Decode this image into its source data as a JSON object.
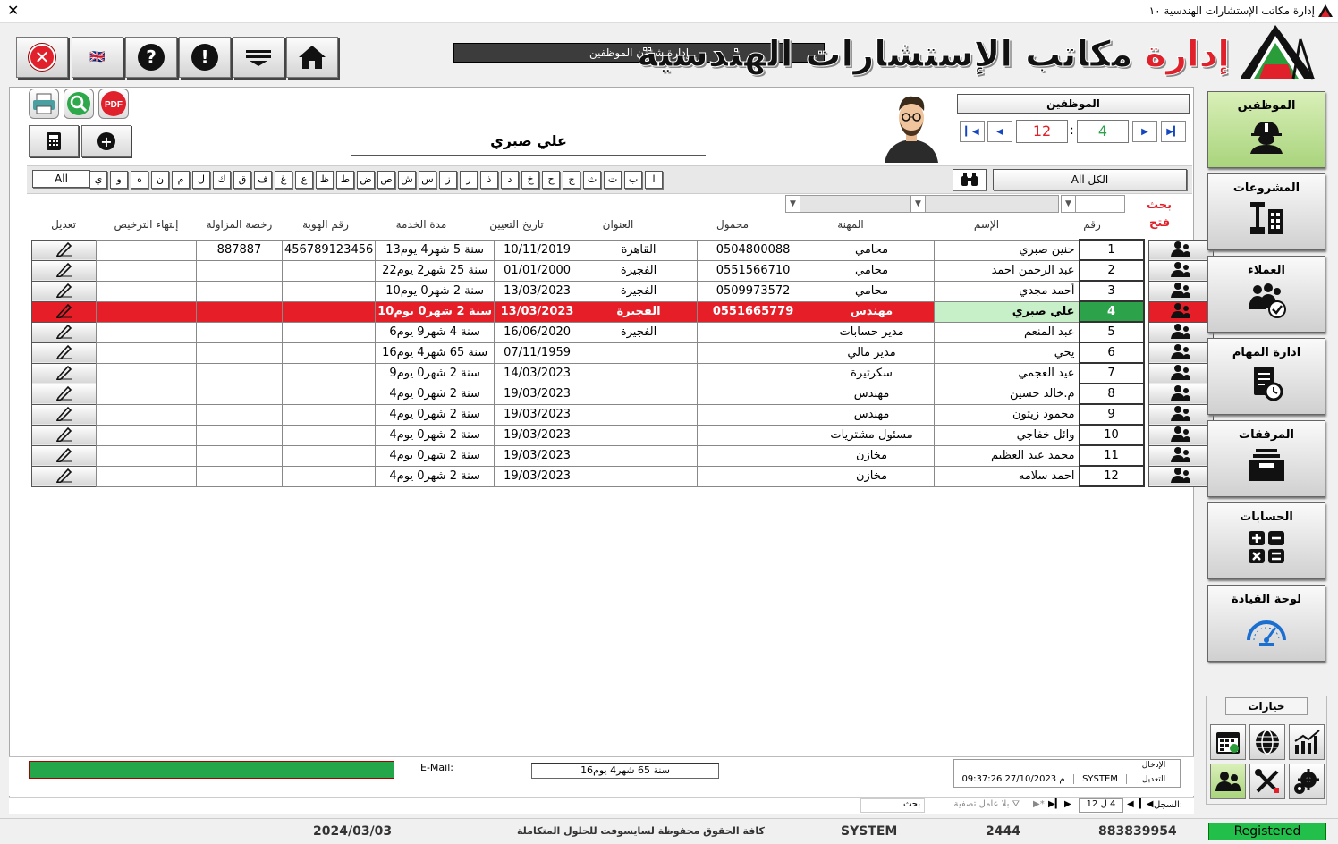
{
  "window": {
    "title": "إدارة مكاتب الإستشارات الهندسية ١٠"
  },
  "brand": {
    "part1": "إدارة ",
    "part2": "مكاتب الإستشارات الهندسية"
  },
  "header": {
    "section_title": "إدارة شؤون الموظفين"
  },
  "toolbar": {
    "lang_flag": "🇬🇧",
    "help": "?",
    "info": "!"
  },
  "employee": {
    "caption": "الموظفين",
    "current_name": "علي صبري",
    "record_current": "4",
    "record_sep": ":",
    "record_total": "12"
  },
  "filter": {
    "all_ar": "الكل All",
    "all_en": "All"
  },
  "letters": [
    "ا",
    "ب",
    "ت",
    "ث",
    "ج",
    "ح",
    "خ",
    "د",
    "ذ",
    "ر",
    "ز",
    "س",
    "ش",
    "ص",
    "ض",
    "ط",
    "ظ",
    "ع",
    "غ",
    "ف",
    "ق",
    "ك",
    "ل",
    "م",
    "ن",
    "ه",
    "و",
    "ي"
  ],
  "search_labels": {
    "search": "بحث",
    "open": "فتح"
  },
  "columns": {
    "num": "رقم",
    "name": "الإسم",
    "job": "المهنة",
    "mobile": "محمول",
    "address": "العنوان",
    "hire_date": "تاريخ التعيين",
    "service": "مدة الخدمة",
    "id_no": "رقم الهوية",
    "license": "رخصة المزاولة",
    "license_end": "إنتهاء الترخيص",
    "edit": "تعديل"
  },
  "rows": [
    {
      "num": "1",
      "name": "حنين صبري",
      "job": "محامي",
      "mobile": "0504800088",
      "address": "القاهرة",
      "hire": "10/11/2019",
      "service": "سنة 5 شهر4 يوم13",
      "id": "456789123456",
      "license": "887887",
      "lend": ""
    },
    {
      "num": "2",
      "name": "عبد الرحمن احمد",
      "job": "محامي",
      "mobile": "0551566710",
      "address": "الفجيرة",
      "hire": "01/01/2000",
      "service": "سنة 25 شهر2 يوم22",
      "id": "",
      "license": "",
      "lend": ""
    },
    {
      "num": "3",
      "name": "أحمد مجدي",
      "job": "محامي",
      "mobile": "0509973572",
      "address": "الفجيرة",
      "hire": "13/03/2023",
      "service": "سنة 2 شهر0 يوم10",
      "id": "",
      "license": "",
      "lend": ""
    },
    {
      "num": "4",
      "name": "علي صبري",
      "job": "مهندس",
      "mobile": "0551665779",
      "address": "الفجيرة",
      "hire": "13/03/2023",
      "service": "سنة 2 شهر0 يوم10",
      "id": "",
      "license": "",
      "lend": ""
    },
    {
      "num": "5",
      "name": "عبد المنعم",
      "job": "مدير حسابات",
      "mobile": "",
      "address": "الفجيرة",
      "hire": "16/06/2020",
      "service": "سنة 4 شهر9 يوم6",
      "id": "",
      "license": "",
      "lend": ""
    },
    {
      "num": "6",
      "name": "يحي",
      "job": "مدير مالي",
      "mobile": "",
      "address": "",
      "hire": "07/11/1959",
      "service": "سنة 65 شهر4 يوم16",
      "id": "",
      "license": "",
      "lend": ""
    },
    {
      "num": "7",
      "name": "عيد العجمي",
      "job": "سكرتيرة",
      "mobile": "",
      "address": "",
      "hire": "14/03/2023",
      "service": "سنة 2 شهر0 يوم9",
      "id": "",
      "license": "",
      "lend": ""
    },
    {
      "num": "8",
      "name": "م.خالد حسين",
      "job": "مهندس",
      "mobile": "",
      "address": "",
      "hire": "19/03/2023",
      "service": "سنة 2 شهر0 يوم4",
      "id": "",
      "license": "",
      "lend": ""
    },
    {
      "num": "9",
      "name": "محمود زيتون",
      "job": "مهندس",
      "mobile": "",
      "address": "",
      "hire": "19/03/2023",
      "service": "سنة 2 شهر0 يوم4",
      "id": "",
      "license": "",
      "lend": ""
    },
    {
      "num": "10",
      "name": "وائل خفاجي",
      "job": "مسئول مشتريات",
      "mobile": "",
      "address": "",
      "hire": "19/03/2023",
      "service": "سنة 2 شهر0 يوم4",
      "id": "",
      "license": "",
      "lend": ""
    },
    {
      "num": "11",
      "name": "محمد عبد العظيم",
      "job": "مخازن",
      "mobile": "",
      "address": "",
      "hire": "19/03/2023",
      "service": "سنة 2 شهر0 يوم4",
      "id": "",
      "license": "",
      "lend": ""
    },
    {
      "num": "12",
      "name": "احمد سلامه",
      "job": "مخازن",
      "mobile": "",
      "address": "",
      "hire": "19/03/2023",
      "service": "سنة 2 شهر0 يوم4",
      "id": "",
      "license": "",
      "lend": ""
    }
  ],
  "sidebar": [
    {
      "label": "الموظفين",
      "icon": "worker-icon"
    },
    {
      "label": "المشروعات",
      "icon": "projects-icon"
    },
    {
      "label": "العملاء",
      "icon": "clients-icon"
    },
    {
      "label": "ادارة المهام",
      "icon": "tasks-icon"
    },
    {
      "label": "المرفقات",
      "icon": "attachments-icon"
    },
    {
      "label": "الحسابات",
      "icon": "accounts-icon"
    },
    {
      "label": "لوحة القيادة",
      "icon": "dashboard-icon"
    }
  ],
  "options": {
    "label": "خيارات"
  },
  "footer": {
    "email_label": "E-Mail:",
    "service_value": "سنة 65 شهر4 يوم16",
    "entry_label": "الإدخال",
    "edit_label": "التعديل",
    "entry_user": "SYSTEM",
    "edit_datetime": "09:37:26 27/10/2023 م"
  },
  "recnav": {
    "label": "السجل:",
    "value": "4 ل 12",
    "nofilter": "بلا عامل تصفية",
    "search": "بحث"
  },
  "status": {
    "date": "2024/03/03",
    "rights": "كافة الحقوق محفوظة لسايسوفت للحلول المتكاملة",
    "user": "SYSTEM",
    "code": "2444",
    "phone": "883839954",
    "registered": "Registered"
  }
}
